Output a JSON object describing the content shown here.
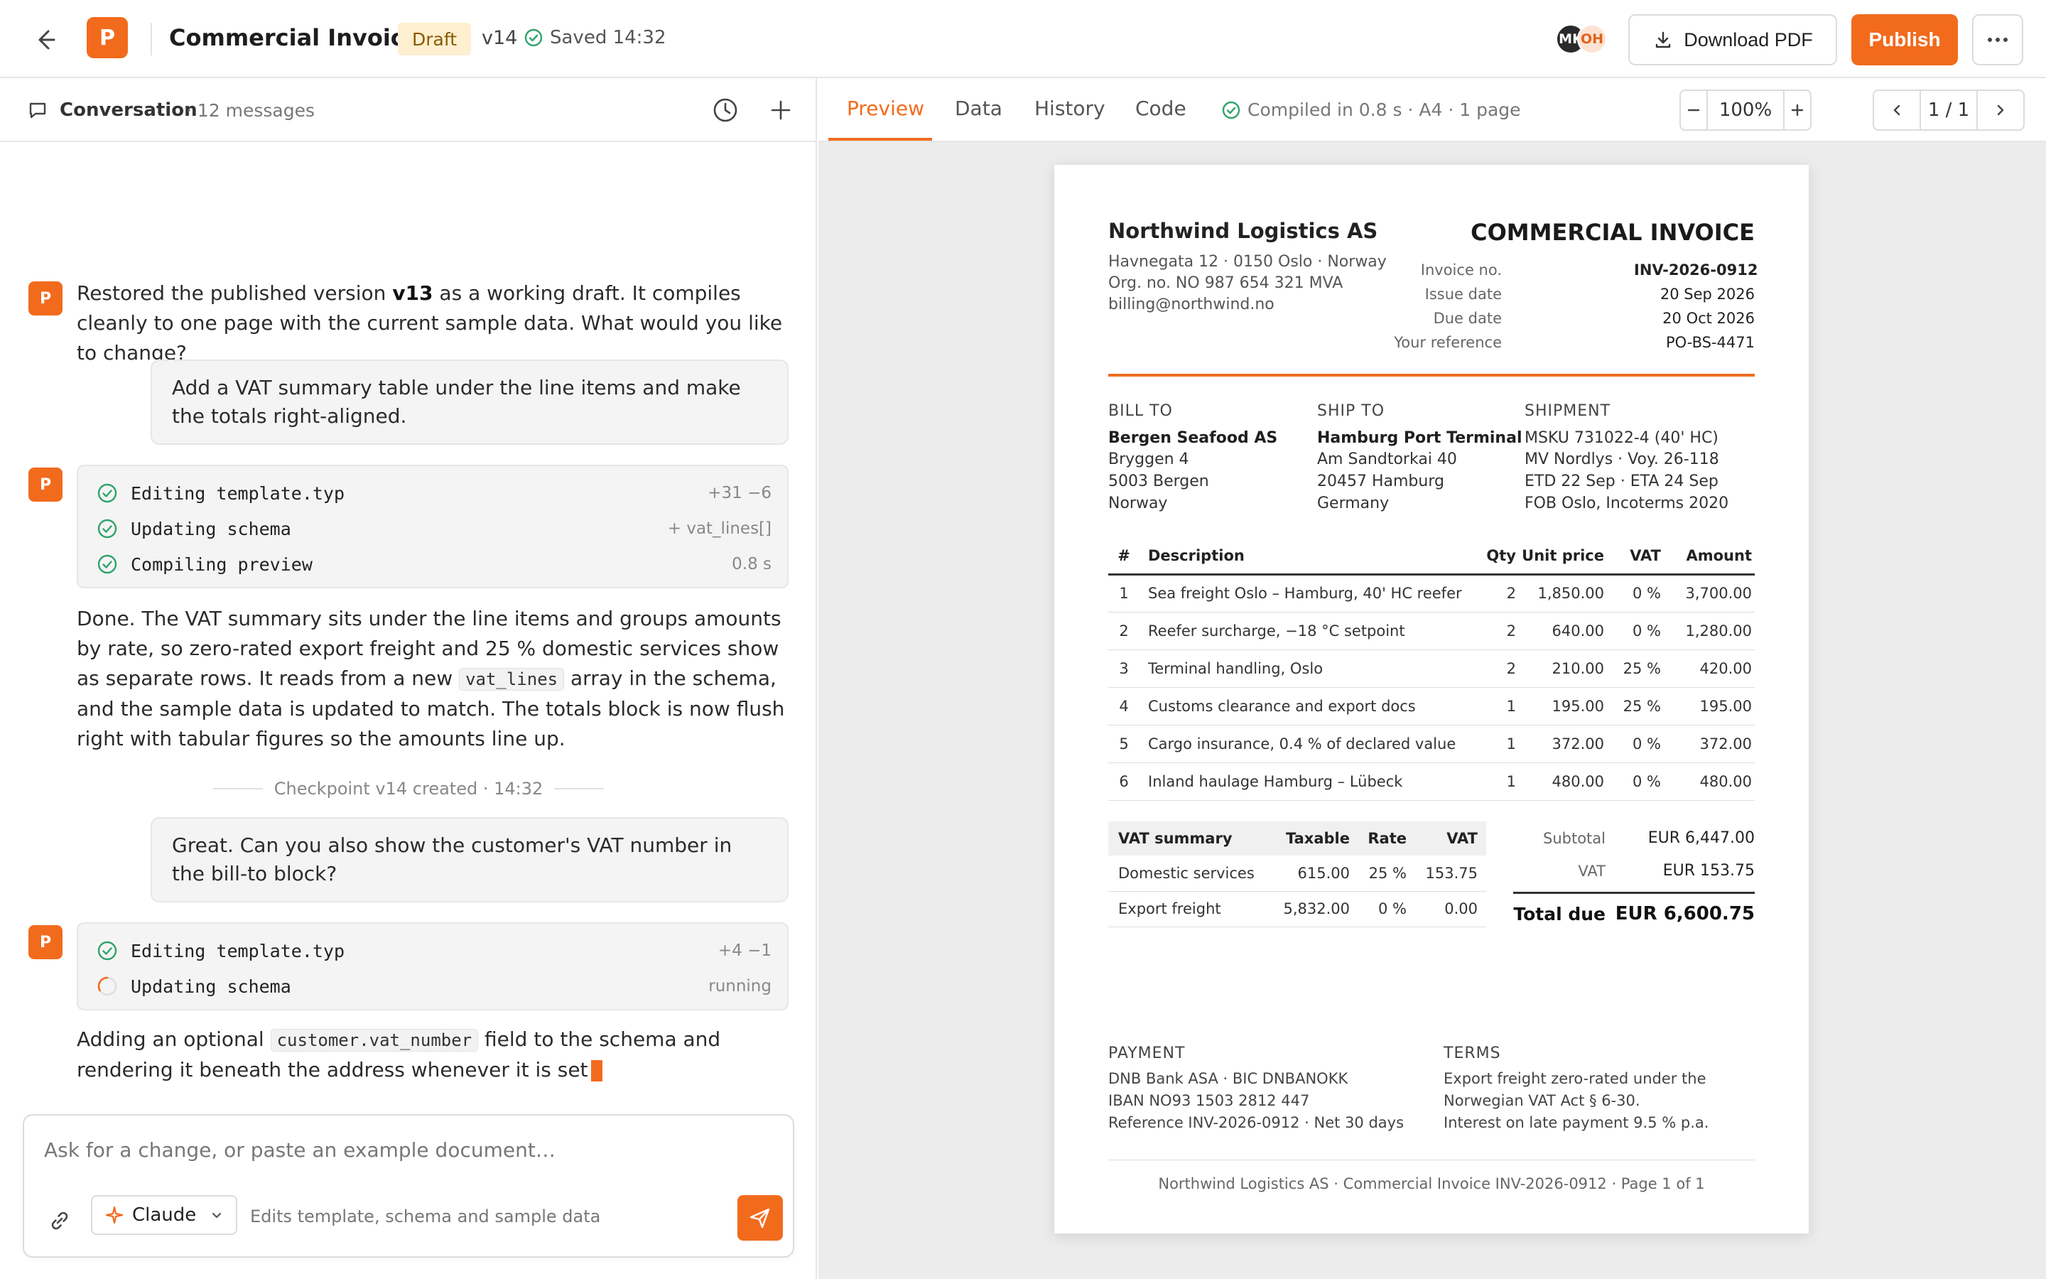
{
  "header": {
    "logo_letter": "P",
    "title": "Commercial Invoice",
    "status_badge": "Draft",
    "version": "v14",
    "saved": "Saved 14:32",
    "avatars": [
      "MK",
      "OH"
    ],
    "download_label": "Download PDF",
    "publish_label": "Publish"
  },
  "conversation": {
    "title": "Conversation",
    "count": "· 12 messages",
    "assistant_avatar": "P",
    "msg1": {
      "pre": "Restored the published version ",
      "bold": "v13",
      "post": " as a working draft. It compiles cleanly to one page with the current sample data. What would you like to change?"
    },
    "user1": "Add a VAT summary table under the line items and make the totals right-aligned.",
    "tools1": [
      {
        "label": "Editing template.typ",
        "meta": "+31 −6",
        "status": "done"
      },
      {
        "label": "Updating schema",
        "meta": "+ vat_lines[]",
        "status": "done"
      },
      {
        "label": "Compiling preview",
        "meta": "0.8 s",
        "status": "done"
      }
    ],
    "msg2": {
      "pre": "Done. The VAT summary sits under the line items and groups amounts by rate, so zero-rated export freight and 25 % domestic services show as separate rows. It reads from a new ",
      "code": "vat_lines",
      "post": " array in the schema, and the sample data is updated to match. The totals block is now flush right with tabular figures so the amounts line up."
    },
    "checkpoint": "Checkpoint v14 created · 14:32",
    "user2": "Great. Can you also show the customer's VAT number in the bill-to block?",
    "tools2": [
      {
        "label": "Editing template.typ",
        "meta": "+4 −1",
        "status": "done"
      },
      {
        "label": "Updating schema",
        "meta": "running",
        "status": "running"
      }
    ],
    "msg3": {
      "pre": "Adding an optional ",
      "code": "customer.vat_number",
      "post": " field to the schema and rendering it beneath the address whenever it is set"
    }
  },
  "composer": {
    "placeholder": "Ask for a change, or paste an example document…",
    "model": "Claude",
    "hint": "Edits template, schema and sample data"
  },
  "preview": {
    "tabs": [
      "Preview",
      "Data",
      "History",
      "Code"
    ],
    "active_tab": "Preview",
    "compiled": "Compiled in 0.8 s · A4 · 1 page",
    "zoom": "100%",
    "page_indicator": "1 / 1"
  },
  "invoice": {
    "company": {
      "name": "Northwind Logistics AS",
      "lines": [
        "Havnegata 12 · 0150 Oslo · Norway",
        "Org. no. NO 987 654 321 MVA",
        "billing@northwind.no"
      ]
    },
    "title": "COMMERCIAL INVOICE",
    "meta": [
      {
        "label": "Invoice no.",
        "value": "INV-2026-0912"
      },
      {
        "label": "Issue date",
        "value": "20 Sep 2026"
      },
      {
        "label": "Due date",
        "value": "20 Oct 2026"
      },
      {
        "label": "Your reference",
        "value": "PO-BS-4471"
      }
    ],
    "bill_to": {
      "heading": "BILL TO",
      "name": "Bergen Seafood AS",
      "lines": [
        "Bryggen 4",
        "5003 Bergen",
        "Norway"
      ]
    },
    "ship_to": {
      "heading": "SHIP TO",
      "name": "Hamburg Port Terminal",
      "lines": [
        "Am Sandtorkai 40",
        "20457 Hamburg",
        "Germany"
      ]
    },
    "shipment": {
      "heading": "SHIPMENT",
      "lines": [
        "MSKU 731022-4 (40' HC)",
        "MV Nordlys · Voy. 26-118",
        "ETD 22 Sep · ETA 24 Sep",
        "FOB Oslo, Incoterms 2020"
      ]
    },
    "items_header": [
      "#",
      "Description",
      "Qty",
      "Unit price",
      "VAT",
      "Amount"
    ],
    "items": [
      {
        "num": "1",
        "desc": "Sea freight Oslo – Hamburg, 40' HC reefer",
        "qty": "2",
        "price": "1,850.00",
        "vat": "0 %",
        "amount": "3,700.00"
      },
      {
        "num": "2",
        "desc": "Reefer surcharge, −18 °C setpoint",
        "qty": "2",
        "price": "640.00",
        "vat": "0 %",
        "amount": "1,280.00"
      },
      {
        "num": "3",
        "desc": "Terminal handling, Oslo",
        "qty": "2",
        "price": "210.00",
        "vat": "25 %",
        "amount": "420.00"
      },
      {
        "num": "4",
        "desc": "Customs clearance and export docs",
        "qty": "1",
        "price": "195.00",
        "vat": "25 %",
        "amount": "195.00"
      },
      {
        "num": "5",
        "desc": "Cargo insurance, 0.4 % of declared value",
        "qty": "1",
        "price": "372.00",
        "vat": "0 %",
        "amount": "372.00"
      },
      {
        "num": "6",
        "desc": "Inland haulage Hamburg – Lübeck",
        "qty": "1",
        "price": "480.00",
        "vat": "0 %",
        "amount": "480.00"
      }
    ],
    "vat_header": [
      "VAT summary",
      "Taxable",
      "Rate",
      "VAT"
    ],
    "vat_rows": [
      {
        "name": "Domestic services",
        "taxable": "615.00",
        "rate": "25 %",
        "vat": "153.75"
      },
      {
        "name": "Export freight",
        "taxable": "5,832.00",
        "rate": "0 %",
        "vat": "0.00"
      }
    ],
    "totals": {
      "subtotal_label": "Subtotal",
      "subtotal": "EUR 6,447.00",
      "vat_label": "VAT",
      "vat": "EUR 153.75",
      "total_label": "Total due",
      "total": "EUR 6,600.75"
    },
    "payment": {
      "heading": "PAYMENT",
      "lines": [
        "DNB Bank ASA · BIC DNBANOKK",
        "IBAN NO93 1503 2812 447",
        "Reference INV-2026-0912 · Net 30 days"
      ]
    },
    "terms": {
      "heading": "TERMS",
      "lines": [
        "Export freight zero-rated under the",
        "Norwegian VAT Act § 6-30.",
        "Interest on late payment 9.5 % p.a."
      ]
    },
    "footer": "Northwind Logistics AS · Commercial Invoice INV-2026-0912 · Page 1 of 1"
  },
  "colors": {
    "accent": "#f26b1d",
    "success": "#2fa36b",
    "draft_bg": "#fdefcf"
  }
}
